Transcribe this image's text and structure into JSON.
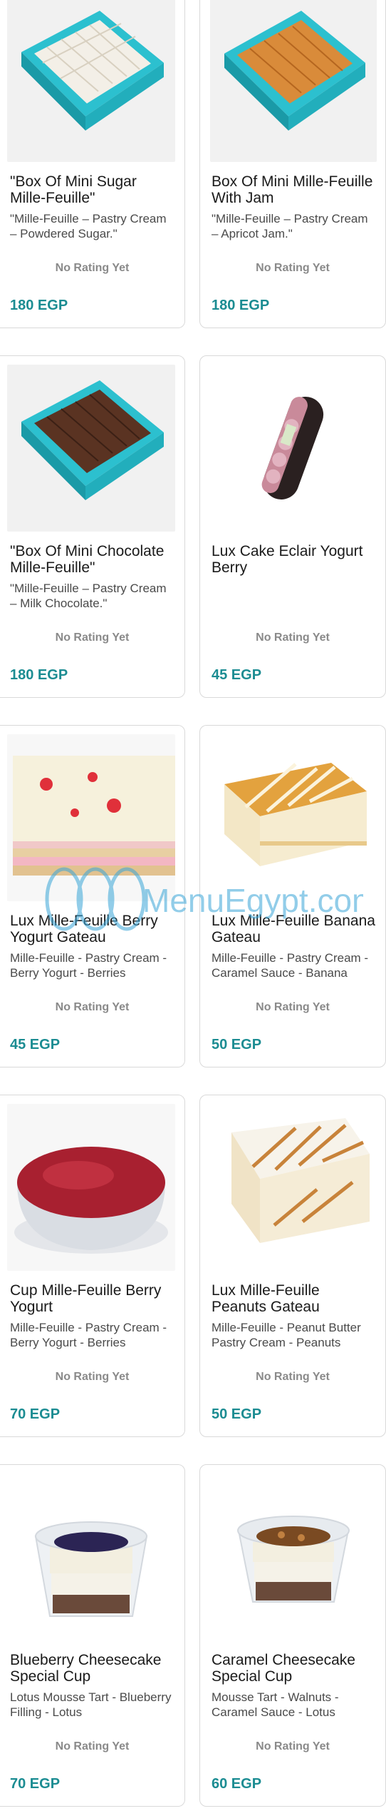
{
  "products": [
    {
      "name": "\"Box Of Mini Sugar Mille-Feuille\"",
      "desc": "\"Mille-Feuille – Pastry Cream – Powdered Sugar.\"",
      "rating": "No Rating Yet",
      "price": "180 EGP",
      "image": "mini-sugar-box"
    },
    {
      "name": "Box Of Mini Mille-Feuille With Jam",
      "desc": "\"Mille-Feuille – Pastry Cream – Apricot Jam.\"",
      "rating": "No Rating Yet",
      "price": "180 EGP",
      "image": "mini-jam-box"
    },
    {
      "name": "\"Box Of Mini Chocolate Mille-Feuille\"",
      "desc": "\"Mille-Feuille – Pastry Cream – Milk Chocolate.\"",
      "rating": "No Rating Yet",
      "price": "180 EGP",
      "image": "mini-chocolate-box"
    },
    {
      "name": "Lux Cake Eclair Yogurt Berry",
      "desc": "",
      "rating": "No Rating Yet",
      "price": "45 EGP",
      "image": "eclair"
    },
    {
      "name": "Lux Mille-Feuille Berry Yogurt Gateau",
      "desc": "Mille-Feuille - Pastry Cream - Berry Yogurt - Berries",
      "rating": "No Rating Yet",
      "price": "45 EGP",
      "image": "berry-gateau"
    },
    {
      "name": "Lux Mille-Feuille Banana Gateau",
      "desc": "Mille-Feuille - Pastry Cream - Caramel Sauce - Banana",
      "rating": "No Rating Yet",
      "price": "50 EGP",
      "image": "banana-gateau"
    },
    {
      "name": "Cup Mille-Feuille Berry Yogurt",
      "desc": "Mille-Feuille - Pastry Cream - Berry Yogurt - Berries",
      "rating": "No Rating Yet",
      "price": "70 EGP",
      "image": "berry-cup"
    },
    {
      "name": "Lux Mille-Feuille Peanuts Gateau",
      "desc": "Mille-Feuille - Peanut Butter Pastry Cream - Peanuts",
      "rating": "No Rating Yet",
      "price": "50 EGP",
      "image": "peanut-gateau"
    },
    {
      "name": "Blueberry Cheesecake Special Cup",
      "desc": "Lotus Mousse Tart - Blueberry Filling - Lotus",
      "rating": "No Rating Yet",
      "price": "70 EGP",
      "image": "blueberry-cup"
    },
    {
      "name": "Caramel Cheesecake Special Cup",
      "desc": "Mousse Tart - Walnuts - Caramel Sauce - Lotus",
      "rating": "No Rating Yet",
      "price": "60 EGP",
      "image": "caramel-cup"
    }
  ],
  "watermark": {
    "text": "MenuEgypt.com"
  },
  "colors": {
    "price": "#1b8c92",
    "box": "#2cc0cf",
    "accent": "#e03a3a"
  }
}
